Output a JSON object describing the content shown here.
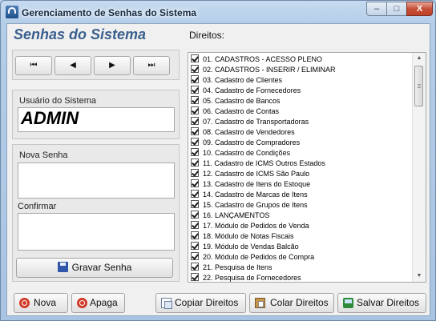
{
  "window": {
    "title": "Gerenciamento de Senhas do Sistema"
  },
  "titlebar_buttons": {
    "minimize": "–",
    "maximize": "□",
    "close": "X"
  },
  "header": {
    "title": "Senhas do Sistema",
    "direitos_label": "Direitos:"
  },
  "nav": {
    "first": "⏮",
    "prev": "◀",
    "next": "▶",
    "last": "⏭"
  },
  "user": {
    "label": "Usuário do Sistema",
    "value": "ADMIN"
  },
  "password": {
    "new_label": "Nova Senha",
    "new_value": "",
    "confirm_label": "Confirmar",
    "confirm_value": ""
  },
  "save_button": {
    "label": "Gravar Senha"
  },
  "permissions": [
    {
      "label": "01. CADASTROS - ACESSO PLENO",
      "checked": true
    },
    {
      "label": "02. CADASTROS - INSERIR / ELIMINAR",
      "checked": true
    },
    {
      "label": "03. Cadastro de Clientes",
      "checked": true
    },
    {
      "label": "04. Cadastro de Fornecedores",
      "checked": true
    },
    {
      "label": "05. Cadastro de Bancos",
      "checked": true
    },
    {
      "label": "06. Cadastro de Contas",
      "checked": true
    },
    {
      "label": "07. Cadastro de Transportadoras",
      "checked": true
    },
    {
      "label": "08. Cadastro de Vendedores",
      "checked": true
    },
    {
      "label": "09. Cadastro de Compradores",
      "checked": true
    },
    {
      "label": "10. Cadastro de Condições",
      "checked": true
    },
    {
      "label": "11. Cadastro de ICMS Outros Estados",
      "checked": true
    },
    {
      "label": "12. Cadastro de ICMS São Paulo",
      "checked": true
    },
    {
      "label": "13. Cadastro de Itens do Estoque",
      "checked": true
    },
    {
      "label": "14. Cadastro de Marcas de Itens",
      "checked": true
    },
    {
      "label": "15. Cadastro de Grupos de Itens",
      "checked": true
    },
    {
      "label": "16. LANÇAMENTOS",
      "checked": true
    },
    {
      "label": "17. Módulo de Pedidos de Venda",
      "checked": true
    },
    {
      "label": "18. Módulo de Notas Fiscais",
      "checked": true
    },
    {
      "label": "19. Módulo de Vendas Balcão",
      "checked": true
    },
    {
      "label": "20. Módulo de Pedidos de Compra",
      "checked": true
    },
    {
      "label": "21. Pesquisa de Itens",
      "checked": true
    },
    {
      "label": "22. Pesquisa de Fornecedores",
      "checked": true
    }
  ],
  "scrollbar": {
    "up": "▲",
    "down": "▼"
  },
  "footer": {
    "nova": "Nova",
    "apaga": "Apaga",
    "copiar": "Copiar Direitos",
    "colar": "Colar Direitos",
    "salvar": "Salvar Direitos"
  }
}
